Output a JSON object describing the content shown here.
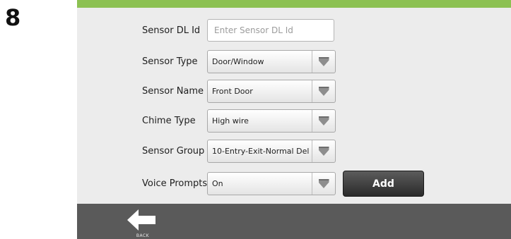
{
  "step": {
    "number": "8"
  },
  "form": {
    "sensor_dl_id": {
      "label": "Sensor DL Id",
      "value": "",
      "placeholder": "Enter Sensor DL Id"
    },
    "sensor_type": {
      "label": "Sensor Type",
      "value": "Door/Window"
    },
    "sensor_name": {
      "label": "Sensor Name",
      "value": "Front Door"
    },
    "chime_type": {
      "label": "Chime Type",
      "value": "High wire"
    },
    "sensor_group": {
      "label": "Sensor Group",
      "value": "10-Entry-Exit-Normal Del"
    },
    "voice_prompts": {
      "label": "Voice Prompts",
      "value": "On"
    },
    "add_label": "Add"
  },
  "nav": {
    "back_label": "BACK",
    "back_icon": "arrow-left-icon"
  },
  "colors": {
    "accent_bar": "#8cc152",
    "bottom_bar": "#5a5a5a",
    "add_button": "#2a2a2a"
  }
}
